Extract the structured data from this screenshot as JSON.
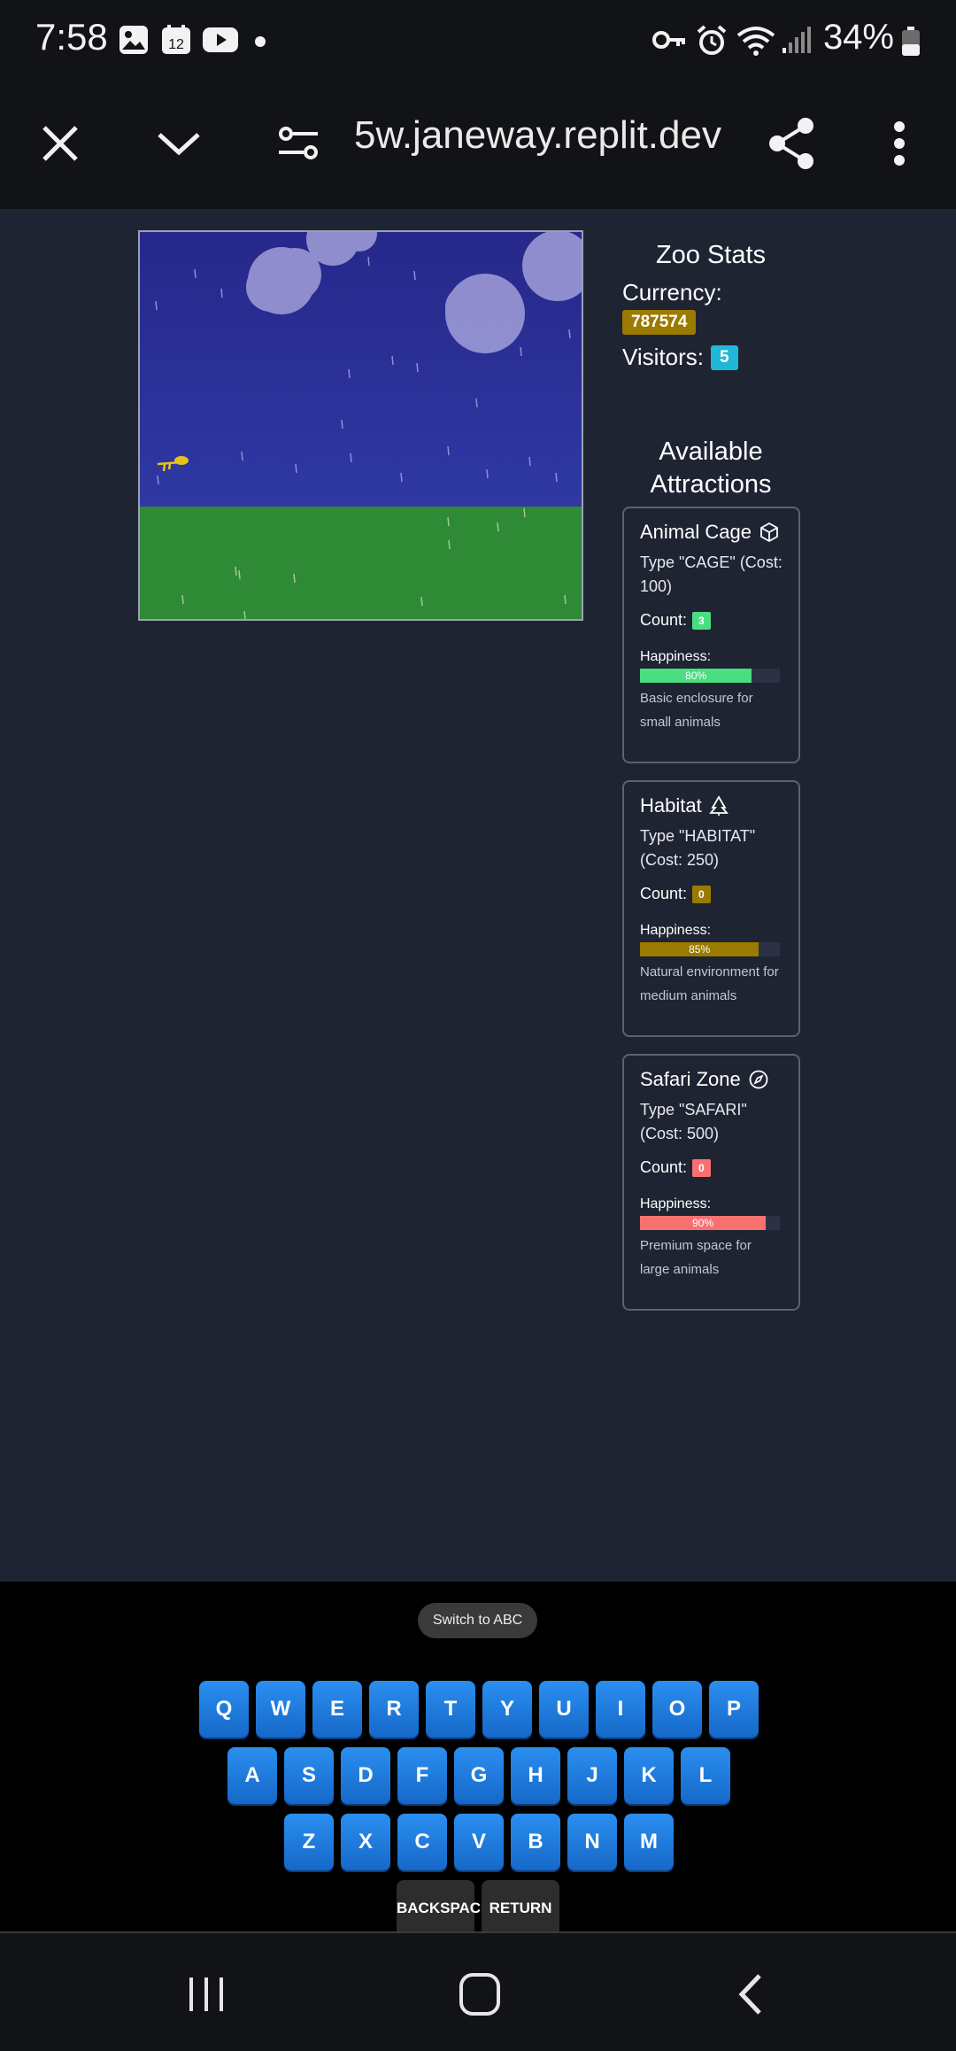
{
  "status_bar": {
    "time": "7:58",
    "calendar_day": "12",
    "battery": "34%"
  },
  "browser": {
    "url": "5w.janeway.replit.dev"
  },
  "zoo_stats": {
    "title": "Zoo Stats",
    "currency_label": "Currency:",
    "currency_value": "787574",
    "visitors_label": "Visitors:",
    "visitors_value": "5"
  },
  "attractions": {
    "title_line1": "Available",
    "title_line2": "Attractions",
    "items": [
      {
        "name": "Animal Cage",
        "icon": "box-icon",
        "type_text": "Type \"CAGE\" (Cost: 100)",
        "count_label": "Count:",
        "count": "3",
        "count_color": "#4ade80",
        "happiness_label": "Happiness:",
        "happiness_pct": 80,
        "happiness_text": "80%",
        "bar_color": "#4ade80",
        "desc": "Basic enclosure for small animals"
      },
      {
        "name": "Habitat",
        "icon": "tree-icon",
        "type_text": "Type \"HABITAT\" (Cost: 250)",
        "count_label": "Count:",
        "count": "0",
        "count_color": "#9a7b00",
        "happiness_label": "Happiness:",
        "happiness_pct": 85,
        "happiness_text": "85%",
        "bar_color": "#9a7b00",
        "desc": "Natural environment for medium animals"
      },
      {
        "name": "Safari Zone",
        "icon": "compass-icon",
        "type_text": "Type \"SAFARI\" (Cost: 500)",
        "count_label": "Count:",
        "count": "0",
        "count_color": "#f87171",
        "happiness_label": "Happiness:",
        "happiness_pct": 90,
        "happiness_text": "90%",
        "bar_color": "#f87171",
        "desc": "Premium space for large animals"
      }
    ]
  },
  "keyboard": {
    "switch_label": "Switch to ABC",
    "row1": [
      "Q",
      "W",
      "E",
      "R",
      "T",
      "Y",
      "U",
      "I",
      "O",
      "P"
    ],
    "row2": [
      "A",
      "S",
      "D",
      "F",
      "G",
      "H",
      "J",
      "K",
      "L"
    ],
    "row3": [
      "Z",
      "X",
      "C",
      "V",
      "B",
      "N",
      "M"
    ],
    "backspace": "BACKSPACE",
    "return": "RETURN"
  },
  "colors": {
    "sky": "#2a2f8f",
    "grass": "#2f8a36",
    "page_bg": "#1f2433",
    "key_blue": "#1f7fe0"
  }
}
